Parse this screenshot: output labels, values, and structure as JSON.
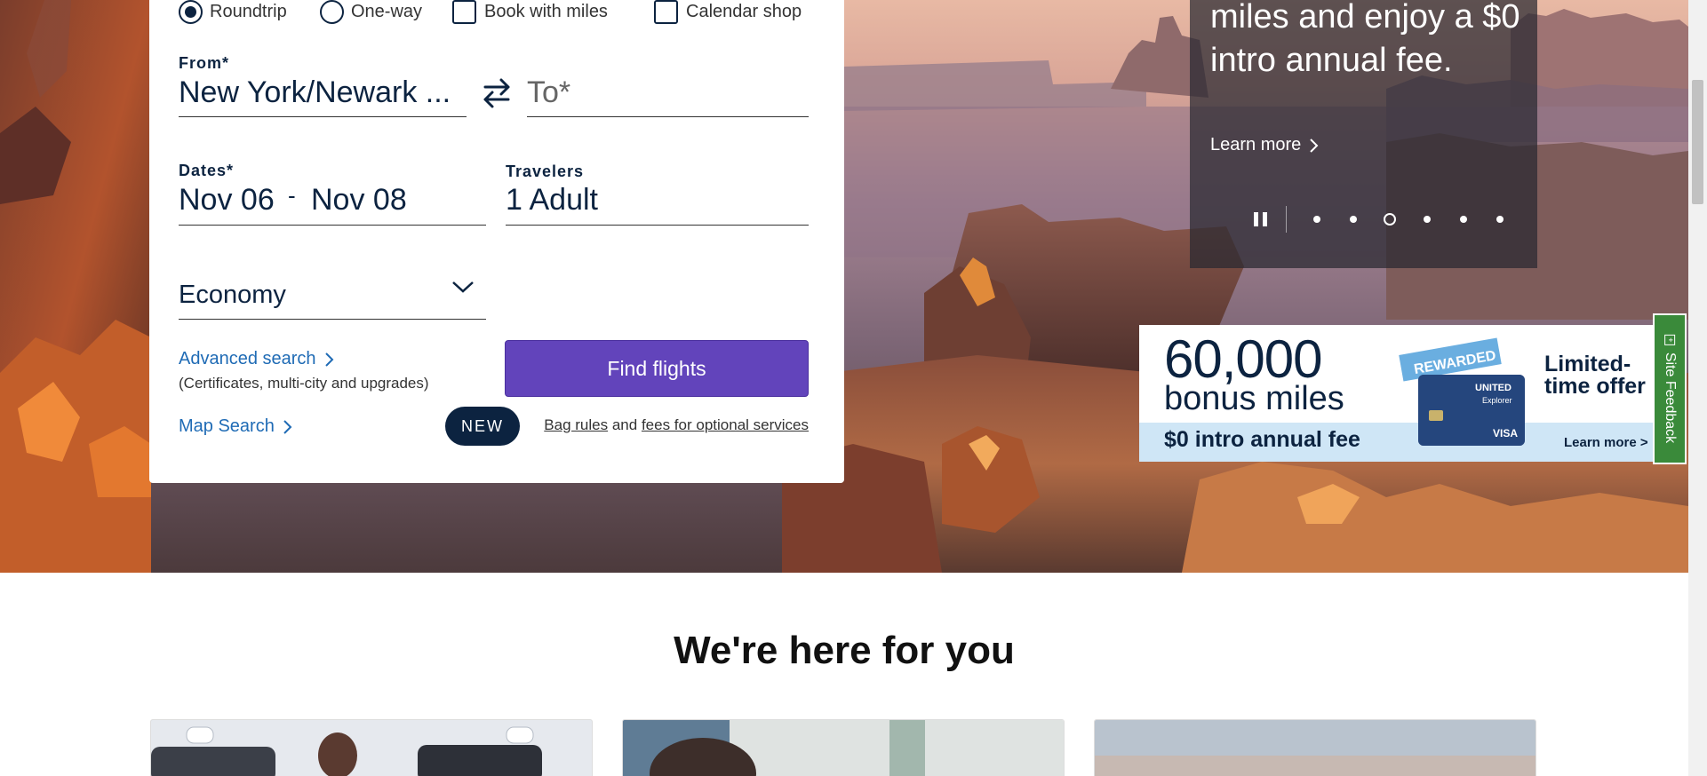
{
  "trip_options": [
    {
      "label": "Roundtrip",
      "selected": true
    },
    {
      "label": "One-way",
      "selected": false
    }
  ],
  "checkboxes": [
    {
      "label": "Book with miles",
      "checked": false
    },
    {
      "label": "Calendar shop",
      "checked": false
    }
  ],
  "from": {
    "label": "From*",
    "value": "New York/Newark ..."
  },
  "to": {
    "placeholder": "To*"
  },
  "dates": {
    "label": "Dates*",
    "start": "Nov 06",
    "separator": "-",
    "end": "Nov 08"
  },
  "travelers": {
    "label": "Travelers",
    "value": "1 Adult"
  },
  "cabin": {
    "value": "Economy"
  },
  "advanced_search": {
    "label": "Advanced search",
    "sub": "(Certificates, multi-city and upgrades)"
  },
  "map_search": {
    "label": "Map Search",
    "badge": "NEW"
  },
  "find_flights": {
    "label": "Find flights"
  },
  "bag_info": {
    "link1": "Bag rules",
    "connector": "and",
    "link2": "fees for optional services"
  },
  "promo": {
    "text": "miles and enjoy a $0 intro annual fee.",
    "learn_more": "Learn more",
    "slide_count": 6,
    "active_slide": 3
  },
  "ad": {
    "big_number": "60,000",
    "bonus": "bonus miles",
    "fee": "$0 intro annual fee",
    "offer": "Limited-time offer",
    "learn_more": "Learn more >",
    "ribbon": "REWARDED",
    "card_brand": "UNITED",
    "card_name": "Explorer",
    "card_network": "VISA"
  },
  "feedback": {
    "label": "Site Feedback"
  },
  "section": {
    "heading": "We're here for you"
  },
  "colors": {
    "navy": "#0c2340",
    "purple": "#6244bb",
    "link": "#1f6bb5",
    "feedback_green": "#3a8a3a"
  }
}
